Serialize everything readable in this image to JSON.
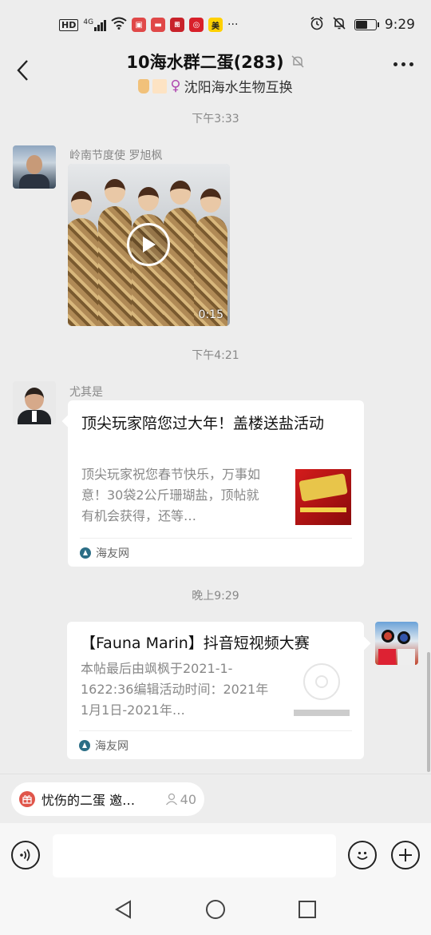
{
  "status_bar": {
    "hd": "HD",
    "network": "4G",
    "time": "9:29",
    "battery_level": 0.55,
    "more_indicator": "···"
  },
  "header": {
    "title": "10海水群二蛋(283)",
    "subtitle": "沈阳海水生物互换",
    "muted_icon": "bell-off-icon"
  },
  "messages": [
    {
      "timestamp": "下午3:33",
      "sender": "岭南节度使 罗旭枫",
      "type": "video",
      "duration": "0:15"
    },
    {
      "timestamp": "下午4:21",
      "sender": "尤其是",
      "type": "link",
      "title": "顶尖玩家陪您过大年！盖楼送盐活动",
      "desc": "顶尖玩家祝您春节快乐，万事如意！30袋2公斤珊瑚盐，顶帖就有机会获得，还等…",
      "source": "海友网"
    },
    {
      "timestamp": "晚上9:29",
      "sender": "",
      "type": "link",
      "title": "【Fauna Marin】抖音短视频大赛",
      "desc": "本帖最后由飒枫于2021-1-1622:36编辑活动时间：2021年1月1日-2021年…",
      "source": "海友网"
    }
  ],
  "notice": {
    "text": "忧伤的二蛋 邀…",
    "count": "40"
  },
  "input": {
    "placeholder": ""
  },
  "colors": {
    "background": "#ededed",
    "bubble": "#ffffff",
    "accent_red": "#e0554a"
  }
}
